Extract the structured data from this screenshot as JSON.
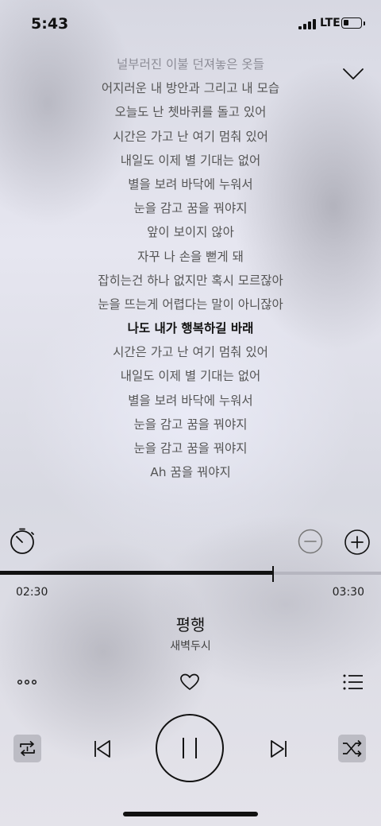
{
  "status_bar": {
    "time": "5:43",
    "network": "LTE"
  },
  "lyrics": [
    {
      "text": "널부러진 이불 던져놓은 옷들",
      "state": "faded"
    },
    {
      "text": "어지러운 내 방안과 그리고 내 모습",
      "state": "normal"
    },
    {
      "text": "오늘도 난 쳇바퀴를 돌고 있어",
      "state": "normal"
    },
    {
      "text": "시간은 가고 난 여기 멈춰 있어",
      "state": "normal"
    },
    {
      "text": "내일도 이제 별 기대는 없어",
      "state": "normal"
    },
    {
      "text": "별을 보려 바닥에 누워서",
      "state": "normal"
    },
    {
      "text": "눈을 감고 꿈을 꿔야지",
      "state": "normal"
    },
    {
      "text": "앞이 보이지 않아",
      "state": "normal"
    },
    {
      "text": "자꾸 나 손을 뻗게 돼",
      "state": "normal"
    },
    {
      "text": "잡히는건 하나 없지만 혹시 모르잖아",
      "state": "normal"
    },
    {
      "text": "눈을 뜨는게 어렵다는 말이 아니잖아",
      "state": "normal"
    },
    {
      "text": "나도 내가 행복하길 바래",
      "state": "current"
    },
    {
      "text": "시간은 가고 난 여기 멈춰 있어",
      "state": "normal"
    },
    {
      "text": "내일도 이제 별 기대는 없어",
      "state": "normal"
    },
    {
      "text": "별을 보려 바닥에 누워서",
      "state": "normal"
    },
    {
      "text": "눈을 감고 꿈을 꿔야지",
      "state": "normal"
    },
    {
      "text": "눈을 감고 꿈을 꿔야지",
      "state": "normal"
    },
    {
      "text": "Ah 꿈을 꿔야지",
      "state": "normal"
    }
  ],
  "player": {
    "elapsed": "02:30",
    "duration": "03:30",
    "progress": 0.717,
    "title": "평행",
    "artist": "새벽두시"
  },
  "icons": {
    "collapse": "chevron-down-icon",
    "timer": "timer-icon",
    "font_decrease": "minus-circle-icon",
    "font_increase": "plus-circle-icon",
    "more": "more-icon",
    "like": "heart-icon",
    "playlist": "playlist-icon",
    "repeat": "repeat-icon",
    "previous": "previous-icon",
    "pause": "pause-icon",
    "next": "next-icon",
    "shuffle": "shuffle-icon"
  }
}
